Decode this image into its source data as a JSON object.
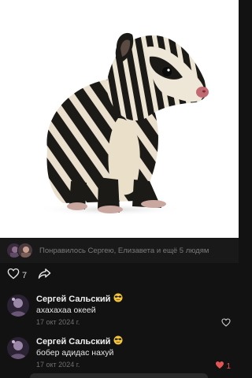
{
  "post": {
    "photo": {
      "subject": "striped-animal-photo"
    },
    "likes_summary": "Понравилось Сергею, Елизавета и ещё 5 людям",
    "like_count": "7"
  },
  "comments": [
    {
      "author": "Сергей Сальский",
      "emoji": "sunglasses-emoji",
      "text": "ахахахаа океей",
      "date": "17 окт 2024 г.",
      "like_count": "",
      "liked": false
    },
    {
      "author": "Сергей Сальский",
      "emoji": "sunglasses-emoji",
      "text": "бобер адидас нахуй",
      "date": "17 окт 2024 г.",
      "like_count": "1",
      "liked": true
    }
  ],
  "colors": {
    "background": "#121212",
    "likes_bar": "#191919",
    "muted_text": "#7a7a7a",
    "liked_heart": "#e35555",
    "emoji_yellow": "#f4c53d"
  }
}
